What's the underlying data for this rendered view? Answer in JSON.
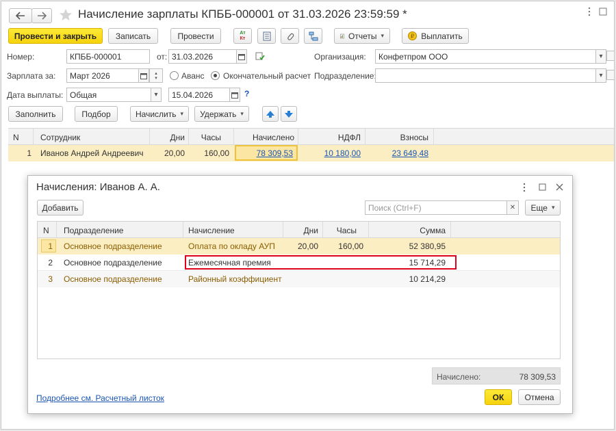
{
  "window": {
    "title": "Начисление зарплаты КПББ-000001 от 31.03.2026 23:59:59 *"
  },
  "toolbar": {
    "post_and_close": "Провести и закрыть",
    "save": "Записать",
    "post": "Провести",
    "dtkt_top": "Ат",
    "dtkt_bottom": "Кт",
    "reports": "Отчеты",
    "pay": "Выплатить"
  },
  "form": {
    "number_label": "Номер:",
    "number_value": "КПББ-000001",
    "date_label": "от:",
    "date_value": "31.03.2026",
    "org_label": "Организация:",
    "org_value": "Конфетпром ООО",
    "salary_for_label": "Зарплата за:",
    "salary_for_value": "Март 2026",
    "advance_label": "Аванс",
    "final_label": "Окончательный расчет",
    "dept_label": "Подразделение:",
    "dept_value": "",
    "paydate_label": "Дата выплаты:",
    "paydate_type": "Общая",
    "paydate_value": "15.04.2026",
    "help": "?"
  },
  "actions": {
    "fill": "Заполнить",
    "select": "Подбор",
    "accrue": "Начислить",
    "withhold": "Удержать"
  },
  "main_table": {
    "headers": [
      "N",
      "Сотрудник",
      "Дни",
      "Часы",
      "Начислено",
      "НДФЛ",
      "Взносы"
    ],
    "rows": [
      {
        "n": "1",
        "employee": "Иванов Андрей Андреевич",
        "days": "20,00",
        "hours": "160,00",
        "accrued": "78 309,53",
        "ndfl": "10 180,00",
        "contrib": "23 649,48"
      }
    ]
  },
  "dialog": {
    "title": "Начисления: Иванов А. А.",
    "add": "Добавить",
    "search_placeholder": "Поиск (Ctrl+F)",
    "more": "Еще",
    "headers": [
      "N",
      "Подразделение",
      "Начисление",
      "Дни",
      "Часы",
      "Сумма"
    ],
    "rows": [
      {
        "n": "1",
        "dept": "Основное подразделение",
        "accrual": "Оплата по окладу АУП",
        "days": "20,00",
        "hours": "160,00",
        "sum": "52 380,95"
      },
      {
        "n": "2",
        "dept": "Основное подразделение",
        "accrual": "Ежемесячная премия",
        "days": "",
        "hours": "",
        "sum": "15 714,29"
      },
      {
        "n": "3",
        "dept": "Основное подразделение",
        "accrual": "Районный коэффициент",
        "days": "",
        "hours": "",
        "sum": "10 214,29"
      }
    ],
    "total_label": "Начислено:",
    "total_value": "78 309,53",
    "payslip_link": "Подробнее см. Расчетный листок",
    "ok": "ОК",
    "cancel": "Отмена"
  },
  "colors": {
    "accent_yellow": "#f5d20d",
    "row_highlight": "#fbeec3",
    "brown_text": "#8a5d00",
    "link_blue": "#1a55b5",
    "highlight_red": "#e0001a"
  }
}
